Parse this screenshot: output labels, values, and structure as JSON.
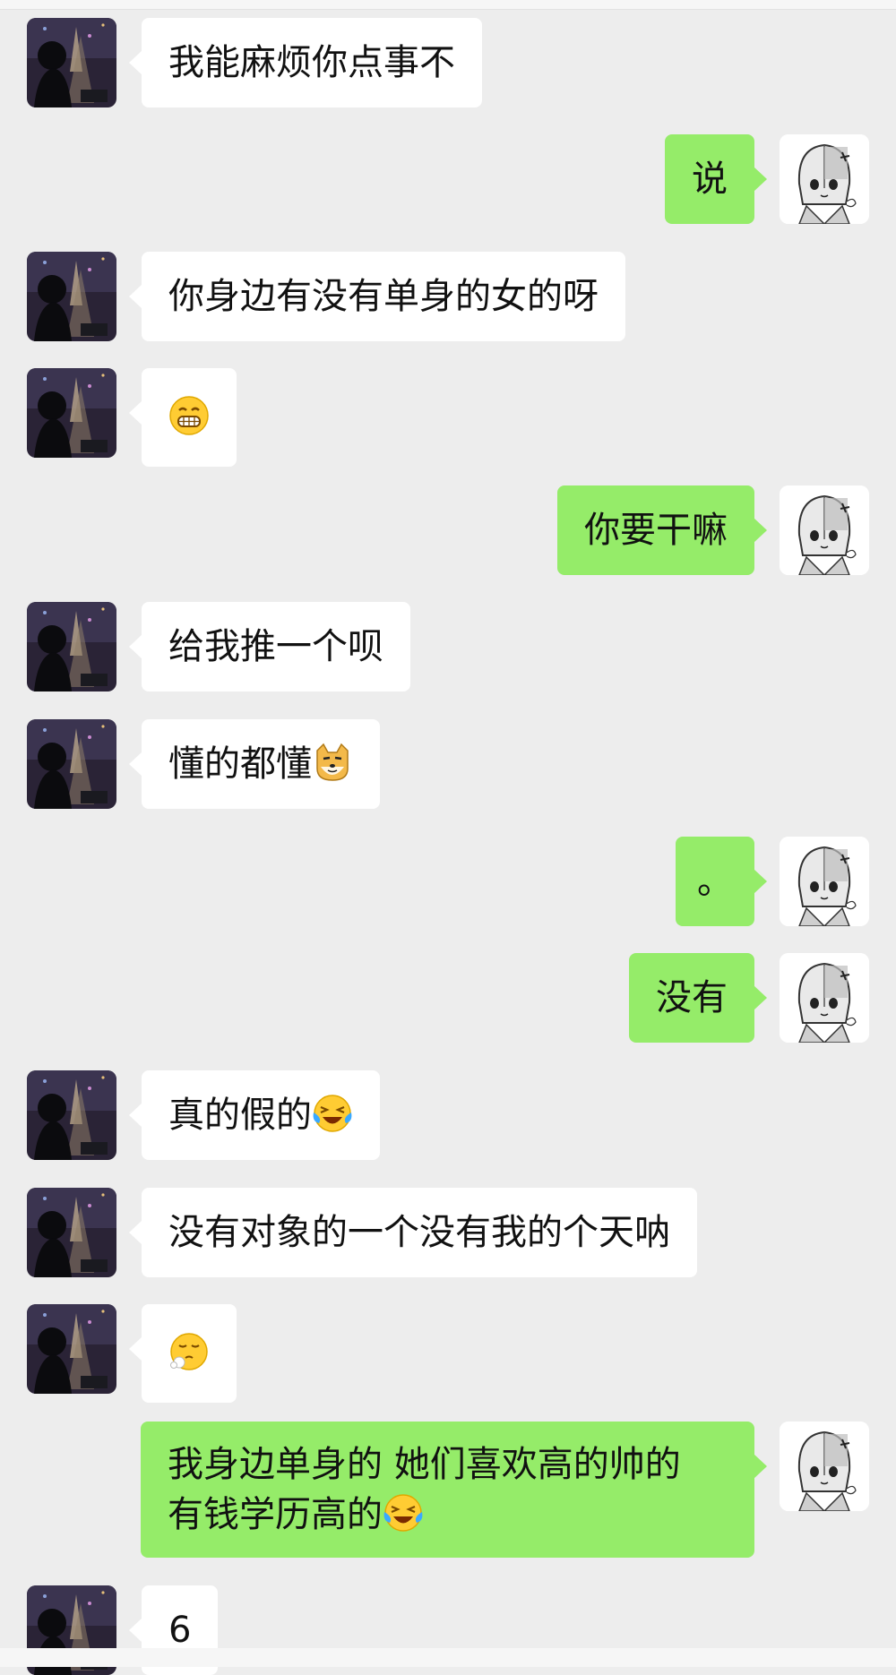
{
  "messages": [
    {
      "from": "other",
      "text": "我能麻烦你点事不"
    },
    {
      "from": "me",
      "text": "说"
    },
    {
      "from": "other",
      "text": "你身边有没有单身的女的呀"
    },
    {
      "from": "other",
      "emoji": "grin-emoji"
    },
    {
      "from": "me",
      "text": "你要干嘛"
    },
    {
      "from": "other",
      "text": "给我推一个呗"
    },
    {
      "from": "other",
      "text": "懂的都懂",
      "emoji": "doge-emoji"
    },
    {
      "from": "me",
      "text": "。"
    },
    {
      "from": "me",
      "text": "没有"
    },
    {
      "from": "other",
      "text": "真的假的",
      "emoji": "laugh-cry-emoji"
    },
    {
      "from": "other",
      "text": "没有对象的一个没有我的个天呐"
    },
    {
      "from": "other",
      "emoji": "sigh-emoji"
    },
    {
      "from": "me",
      "line1": "我身边单身的 她们喜欢高的帅的",
      "line2": "有钱学历高的",
      "emoji": "laugh-cry-emoji"
    },
    {
      "from": "other",
      "text": "6"
    }
  ],
  "colors": {
    "background": "#ededed",
    "incoming": "#ffffff",
    "outgoing": "#95ec69"
  }
}
